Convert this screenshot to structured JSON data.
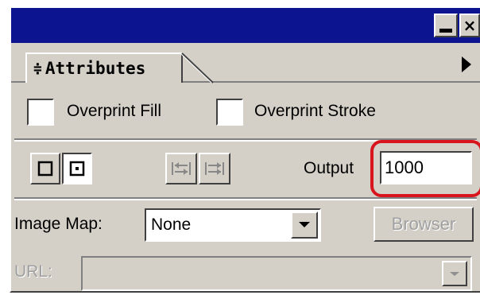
{
  "window": {
    "minimize_icon": "minimize-icon",
    "close_glyph": "×",
    "title_bar_color": "#0c1490"
  },
  "tab": {
    "label": "Attributes",
    "updown_glyph": "≑",
    "menu_icon": "right-triangle-icon"
  },
  "overprint": {
    "fill_label": "Overprint Fill",
    "stroke_label": "Overprint Stroke",
    "fill_checked": false,
    "stroke_checked": false
  },
  "output": {
    "label": "Output",
    "value": "1000",
    "highlight_color": "#d8141c"
  },
  "image_map": {
    "label": "Image Map:",
    "selected": "None",
    "browser_label": "Browser"
  },
  "url": {
    "label": "URL:",
    "value": ""
  }
}
